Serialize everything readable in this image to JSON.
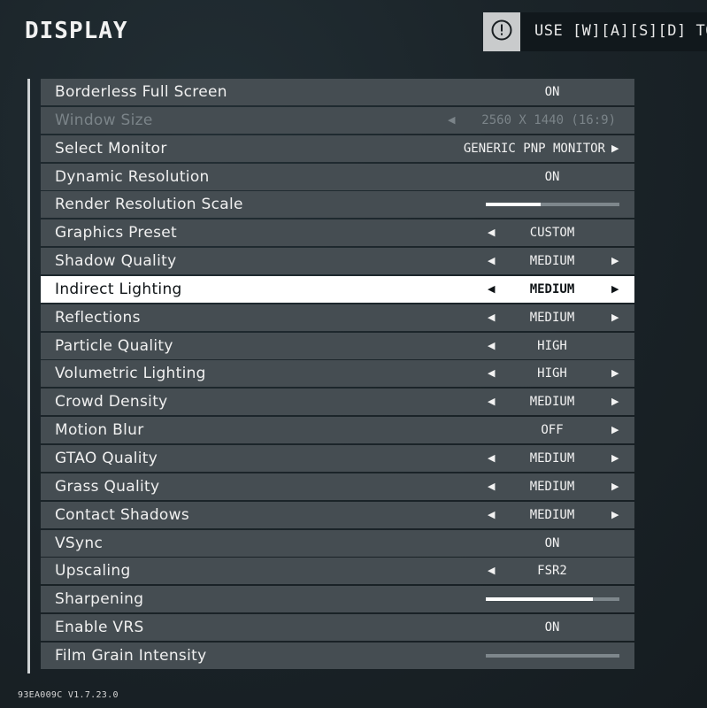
{
  "header": {
    "title": "DISPLAY",
    "hint_icon": "alert-circle-icon",
    "hint_text": "USE [W][A][S][D] TO"
  },
  "settings": [
    {
      "label": "Borderless Full Screen",
      "value": "ON",
      "left_arrow": false,
      "right_arrow": false
    },
    {
      "label": "Window Size",
      "value": "2560 X 1440 (16:9)",
      "left_arrow": true,
      "right_arrow": false,
      "disabled": true
    },
    {
      "label": "Select Monitor",
      "value": "GENERIC PNP MONITOR",
      "left_arrow": false,
      "right_arrow": true
    },
    {
      "label": "Dynamic Resolution",
      "value": "ON",
      "left_arrow": false,
      "right_arrow": false
    },
    {
      "label": "Render Resolution Scale",
      "slider": 0.41
    },
    {
      "label": "Graphics Preset",
      "value": "CUSTOM",
      "left_arrow": true,
      "right_arrow": false
    },
    {
      "label": "Shadow Quality",
      "value": "MEDIUM",
      "left_arrow": true,
      "right_arrow": true
    },
    {
      "label": "Indirect Lighting",
      "value": "MEDIUM",
      "left_arrow": true,
      "right_arrow": true,
      "selected": true
    },
    {
      "label": "Reflections",
      "value": "MEDIUM",
      "left_arrow": true,
      "right_arrow": true
    },
    {
      "label": "Particle Quality",
      "value": "HIGH",
      "left_arrow": true,
      "right_arrow": false
    },
    {
      "label": "Volumetric Lighting",
      "value": "HIGH",
      "left_arrow": true,
      "right_arrow": true
    },
    {
      "label": "Crowd Density",
      "value": "MEDIUM",
      "left_arrow": true,
      "right_arrow": true
    },
    {
      "label": "Motion Blur",
      "value": "OFF",
      "left_arrow": false,
      "right_arrow": true
    },
    {
      "label": "GTAO Quality",
      "value": "MEDIUM",
      "left_arrow": true,
      "right_arrow": true
    },
    {
      "label": "Grass Quality",
      "value": "MEDIUM",
      "left_arrow": true,
      "right_arrow": true
    },
    {
      "label": "Contact Shadows",
      "value": "MEDIUM",
      "left_arrow": true,
      "right_arrow": true
    },
    {
      "label": "VSync",
      "value": "ON",
      "left_arrow": false,
      "right_arrow": false
    },
    {
      "label": "Upscaling",
      "value": "FSR2",
      "left_arrow": true,
      "right_arrow": false
    },
    {
      "label": "Sharpening",
      "slider": 0.8
    },
    {
      "label": "Enable VRS",
      "value": "ON",
      "left_arrow": false,
      "right_arrow": false
    },
    {
      "label": "Film Grain Intensity",
      "slider": 0.0
    }
  ],
  "footer": {
    "version": "93EA009C V1.7.23.0"
  },
  "colors": {
    "row_bg": "#454d52",
    "selected_bg": "#ffffff",
    "slider_fill": "#ffffff",
    "slider_track": "#7e878c"
  }
}
